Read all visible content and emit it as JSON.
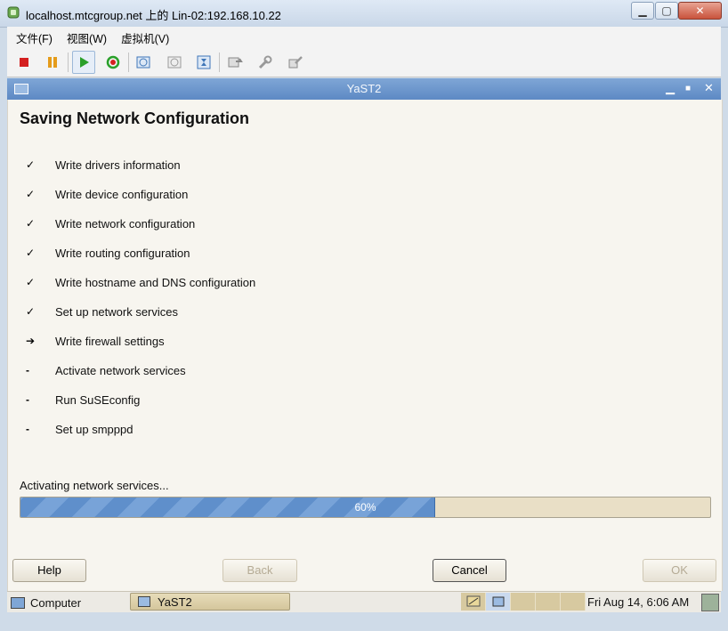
{
  "host": {
    "title": "localhost.mtcgroup.net 上的 Lin-02:192.168.10.22",
    "menu": [
      "文件(F)",
      "视图(W)",
      "虚拟机(V)"
    ]
  },
  "yast": {
    "window_title": "YaST2",
    "heading": "Saving Network Configuration",
    "steps": [
      {
        "mark": "✓",
        "label": "Write drivers information"
      },
      {
        "mark": "✓",
        "label": "Write device configuration"
      },
      {
        "mark": "✓",
        "label": "Write network configuration"
      },
      {
        "mark": "✓",
        "label": "Write routing configuration"
      },
      {
        "mark": "✓",
        "label": "Write hostname and DNS configuration"
      },
      {
        "mark": "✓",
        "label": "Set up network services"
      },
      {
        "mark": "➔",
        "label": "Write firewall settings"
      },
      {
        "mark": "-",
        "label": "Activate network services"
      },
      {
        "mark": "-",
        "label": "Run SuSEconfig"
      },
      {
        "mark": "-",
        "label": "Set up smpppd"
      }
    ],
    "status": "Activating network services...",
    "progress": {
      "percent": 60,
      "label": "60%"
    },
    "buttons": {
      "help": "Help",
      "back": "Back",
      "cancel": "Cancel",
      "ok": "OK"
    }
  },
  "taskbar": {
    "computer": "Computer",
    "task": "YaST2",
    "clock": "Fri Aug 14,  6:06 AM"
  },
  "colors": {
    "accent": "#5d89c4",
    "progress": "#6a98d0",
    "body_bg": "#f7f5ef"
  }
}
